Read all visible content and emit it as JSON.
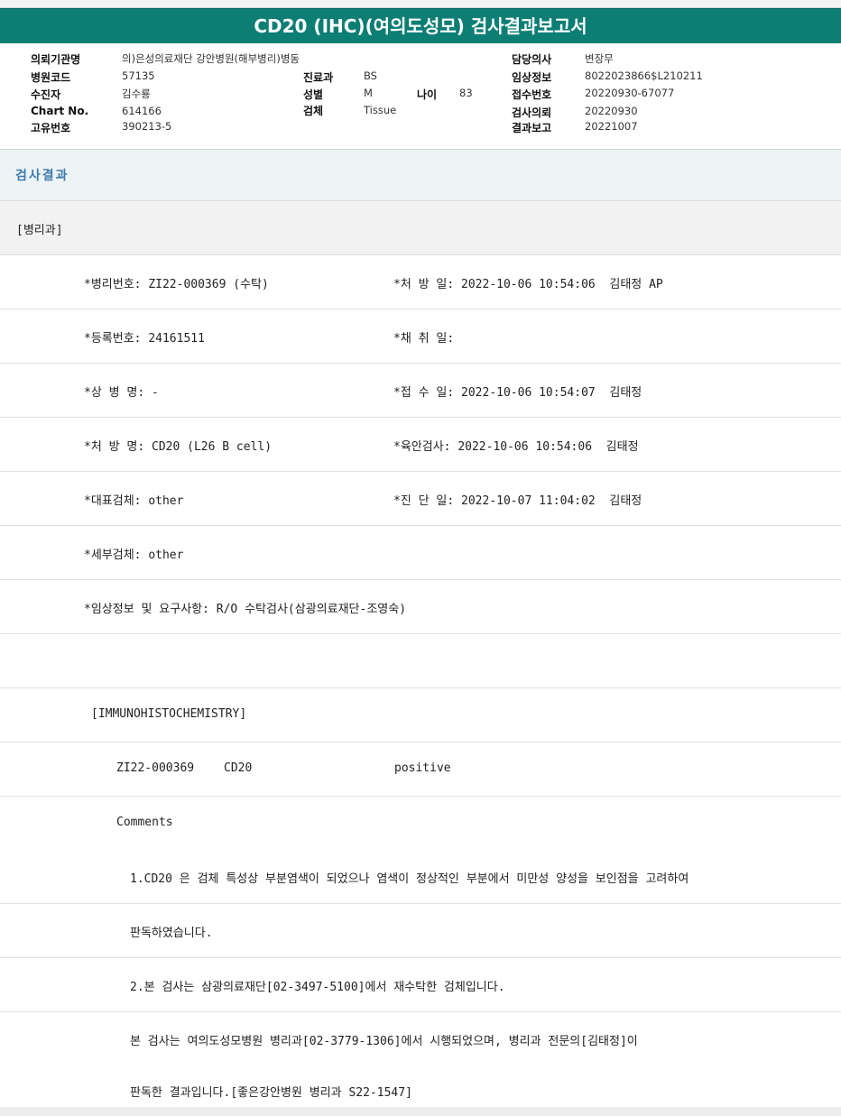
{
  "title": "CD20 (IHC)(여의도성모) 검사결과보고서",
  "info": {
    "institution_label": "의뢰기관명",
    "institution_value": "의)은성의료재단 강안병원(해부병리)병동",
    "hospital_code_label": "병원코드",
    "hospital_code_value": "57135",
    "patient_label": "수진자",
    "patient_value": "김수룡",
    "chart_label": "Chart No.",
    "chart_value": "614166",
    "unique_label": "고유번호",
    "unique_value": "390213-5",
    "dept_label": "진료과",
    "dept_value": "BS",
    "sex_label": "성별",
    "sex_value": "M",
    "age_label": "나이",
    "age_value": "83",
    "specimen_label": "검체",
    "specimen_value": "Tissue",
    "doctor_label": "담당의사",
    "doctor_value": "변장무",
    "clinical_label": "임상정보",
    "clinical_value": "8022023866$L210211",
    "receipt_label": "접수번호",
    "receipt_value": "20220930-67077",
    "request_label": "검사의뢰",
    "request_value": "20220930",
    "report_label": "결과보고",
    "report_value": "20221007"
  },
  "section_title": "검사결과",
  "department": "[병리과]",
  "rows": [
    {
      "left": "*병리번호: ZI22-000369 (수탁)",
      "right": "*처 방 일: 2022-10-06 10:54:06  김태정 AP"
    },
    {
      "left": "*등록번호: 24161511",
      "right": "*채 취 일:"
    },
    {
      "left": "*상 병 명: -",
      "right": "*접 수 일: 2022-10-06 10:54:07  김태정"
    },
    {
      "left": "*처 방 명: CD20 (L26 B cell)",
      "right": "*육안검사: 2022-10-06 10:54:06  김태정"
    },
    {
      "left": "*대표검체: other",
      "right": "*진 단 일: 2022-10-07 11:04:02  김태정"
    },
    {
      "left": "*세부검체: other",
      "right": ""
    },
    {
      "left": "*임상정보 및 요구사항: R/O 수탁검사(삼광의료재단-조영숙)",
      "right": ""
    },
    {
      "left": "",
      "right": ""
    }
  ],
  "ihc_header": "[IMMUNOHISTOCHEMISTRY]",
  "ihc_result": {
    "case": "ZI22-000369",
    "marker": "CD20",
    "result": "positive"
  },
  "comments_label": "Comments",
  "comment_lines": [
    "1.CD20 은 검체 특성상 부분염색이 되었으나 염색이 정상적인 부분에서 미만성 양성을 보인점을 고려하여",
    "판독하였습니다.",
    "2.본 검사는 삼광의료재단[02-3497-5100]에서 재수탁한 검체입니다.",
    "본 검사는 여의도성모병원 병리과[02-3779-1306]에서 시행되었으며, 병리과 전문의[김태정]이",
    "판독한 결과입니다.[좋은강안병원 병리과 S22-1547]"
  ]
}
